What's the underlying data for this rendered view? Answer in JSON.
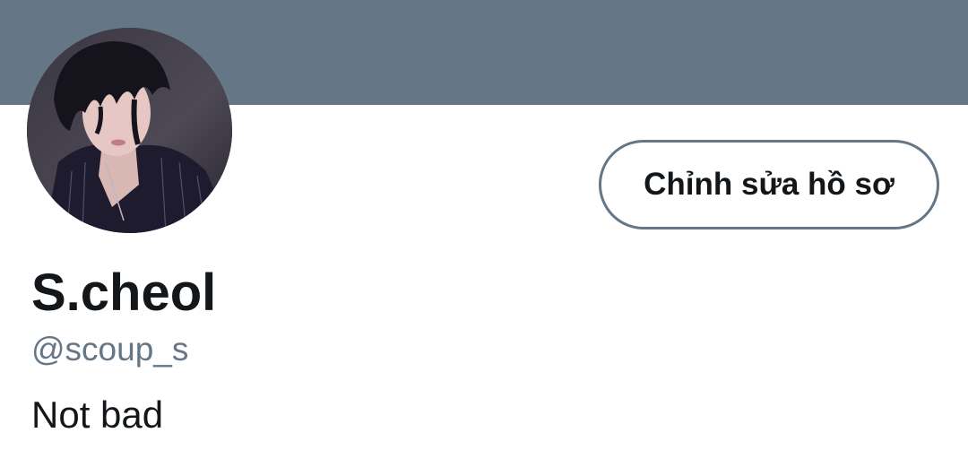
{
  "profile": {
    "display_name": "S.cheol",
    "handle": "@scoup_s",
    "bio": "Not bad",
    "edit_button_label": "Chỉnh sửa hồ sơ"
  },
  "colors": {
    "banner": "#657786",
    "text_primary": "#14171a",
    "text_secondary": "#657786"
  }
}
